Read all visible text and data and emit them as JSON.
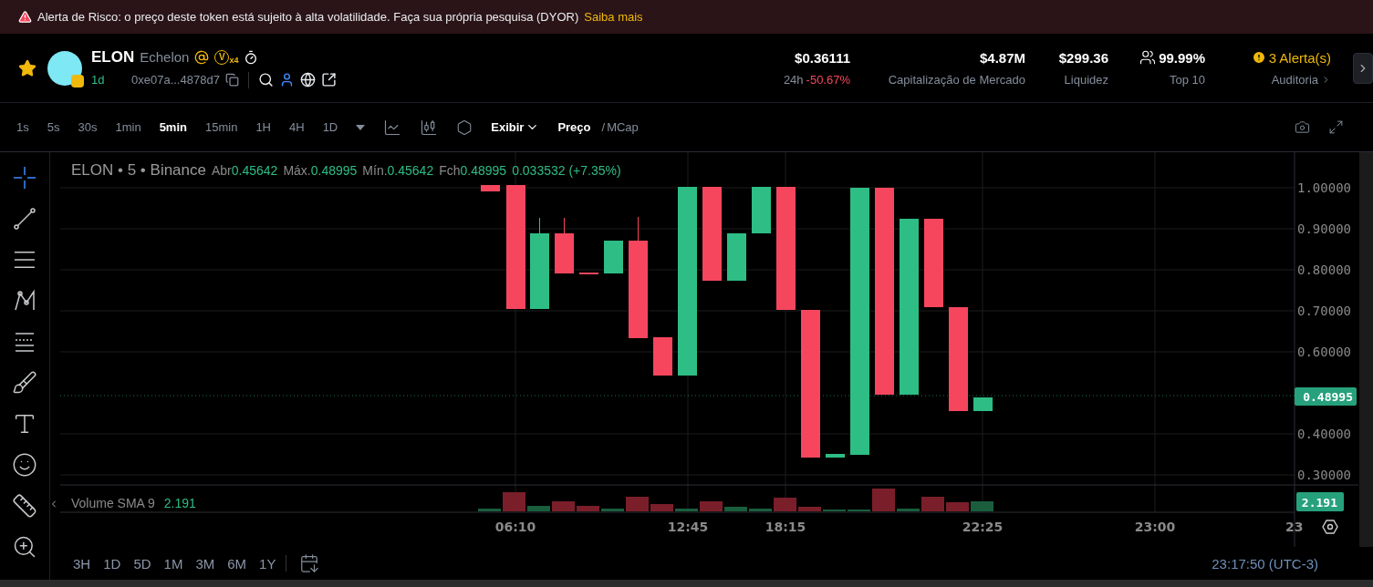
{
  "banner": {
    "message": "Alerta de Risco: o preço deste token está sujeito à alta volatilidade. Faça sua própria pesquisa (DYOR)",
    "link": "Saiba mais"
  },
  "token": {
    "favorite": true,
    "symbol": "ELON",
    "name": "Echelon",
    "badge_letter": "V",
    "badge_count": "x4",
    "age": "1d",
    "address": "0xe07a...4878d7"
  },
  "price": {
    "value": "$0.36111",
    "period": "24h",
    "change": "-50.67%"
  },
  "stats": [
    {
      "value": "$4.87M",
      "label": "Capitalização de Mercado"
    },
    {
      "value": "$299.36",
      "label": "Liquidez"
    }
  ],
  "holders": {
    "value": "99.99%",
    "label": "Top 10"
  },
  "audit": {
    "alerts": "3 Alerta(s)",
    "label": "Auditoria"
  },
  "intervals": [
    {
      "label": "1s",
      "selected": false
    },
    {
      "label": "5s",
      "selected": false
    },
    {
      "label": "30s",
      "selected": false
    },
    {
      "label": "1min",
      "selected": false
    },
    {
      "label": "5min",
      "selected": true
    },
    {
      "label": "15min",
      "selected": false
    },
    {
      "label": "1H",
      "selected": false
    },
    {
      "label": "4H",
      "selected": false
    },
    {
      "label": "1D",
      "selected": false
    }
  ],
  "display_menu": "Exibir",
  "price_toggle": [
    {
      "label": "Preço",
      "selected": true
    },
    {
      "label": "MCap",
      "selected": false
    }
  ],
  "toggle_separator": "/",
  "tools": [
    {
      "kind": "crosshair",
      "selected": true
    },
    {
      "kind": "trendline",
      "selected": false
    },
    {
      "kind": "hlines",
      "selected": false
    },
    {
      "kind": "pattern",
      "selected": false
    },
    {
      "kind": "fib",
      "selected": false
    },
    {
      "kind": "brush",
      "selected": false
    },
    {
      "kind": "text",
      "selected": false
    },
    {
      "kind": "emoji",
      "selected": false
    },
    {
      "kind": "ruler",
      "selected": false
    },
    {
      "kind": "zoom",
      "selected": false
    }
  ],
  "legend": {
    "title": "ELON • 5 • Binance",
    "fields": [
      {
        "label": "Abr",
        "value": "0.45642"
      },
      {
        "label": "Máx.",
        "value": "0.48995"
      },
      {
        "label": "Mín.",
        "value": "0.45642"
      },
      {
        "label": "Fch",
        "value": "0.48995"
      }
    ],
    "change": "0.033532 (+7.35%)"
  },
  "volume": {
    "label": "Volume SMA 9",
    "value": "2.191"
  },
  "price_ticks": [
    "1.00000",
    "0.90000",
    "0.80000",
    "0.70000",
    "0.60000",
    "0.40000",
    "0.30000"
  ],
  "last_price": "0.48995",
  "volume_tag": "2.191",
  "time_labels": [
    "06:10",
    "12:45",
    "18:15",
    "22:25",
    "23:00",
    "23"
  ],
  "ranges": [
    "3H",
    "1D",
    "5D",
    "1M",
    "3M",
    "6M",
    "1Y"
  ],
  "clock": "23:17:50 (UTC-3)"
}
